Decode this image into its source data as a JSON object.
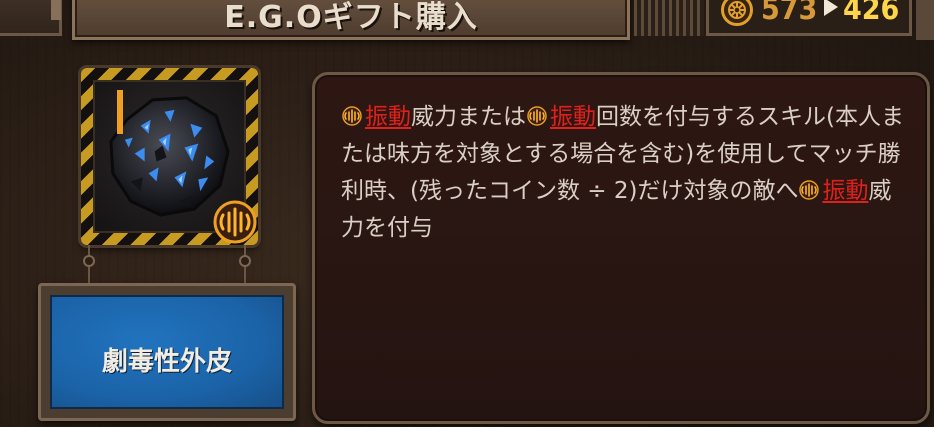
{
  "header": {
    "title": "E.G.Oギフト購入"
  },
  "currency": {
    "icon": "cog-coin-icon",
    "old_value": "573",
    "new_value": "426",
    "old_color": "#d79a3a",
    "new_color": "#ffd54a"
  },
  "gift": {
    "tier": "I",
    "name": "劇毒性外皮",
    "keyword_icon": "vibration-icon",
    "frame_color": "#c79a22",
    "plate_color": "#1b63a8"
  },
  "description": {
    "segments": [
      {
        "type": "icon",
        "name": "vibration-icon"
      },
      {
        "type": "keyword",
        "text": "振動"
      },
      {
        "type": "text",
        "text": "威力または"
      },
      {
        "type": "icon",
        "name": "vibration-icon"
      },
      {
        "type": "keyword",
        "text": "振動"
      },
      {
        "type": "text",
        "text": "回数を付与するスキル(本人または味方を対象とする場合を含む)を使用してマッチ勝利時、(残ったコイン数 ÷ 2)だけ対象の敵へ"
      },
      {
        "type": "icon",
        "name": "vibration-icon"
      },
      {
        "type": "keyword",
        "text": "振動"
      },
      {
        "type": "text",
        "text": "威力を付与"
      }
    ],
    "keyword_color": "#e0201a"
  }
}
